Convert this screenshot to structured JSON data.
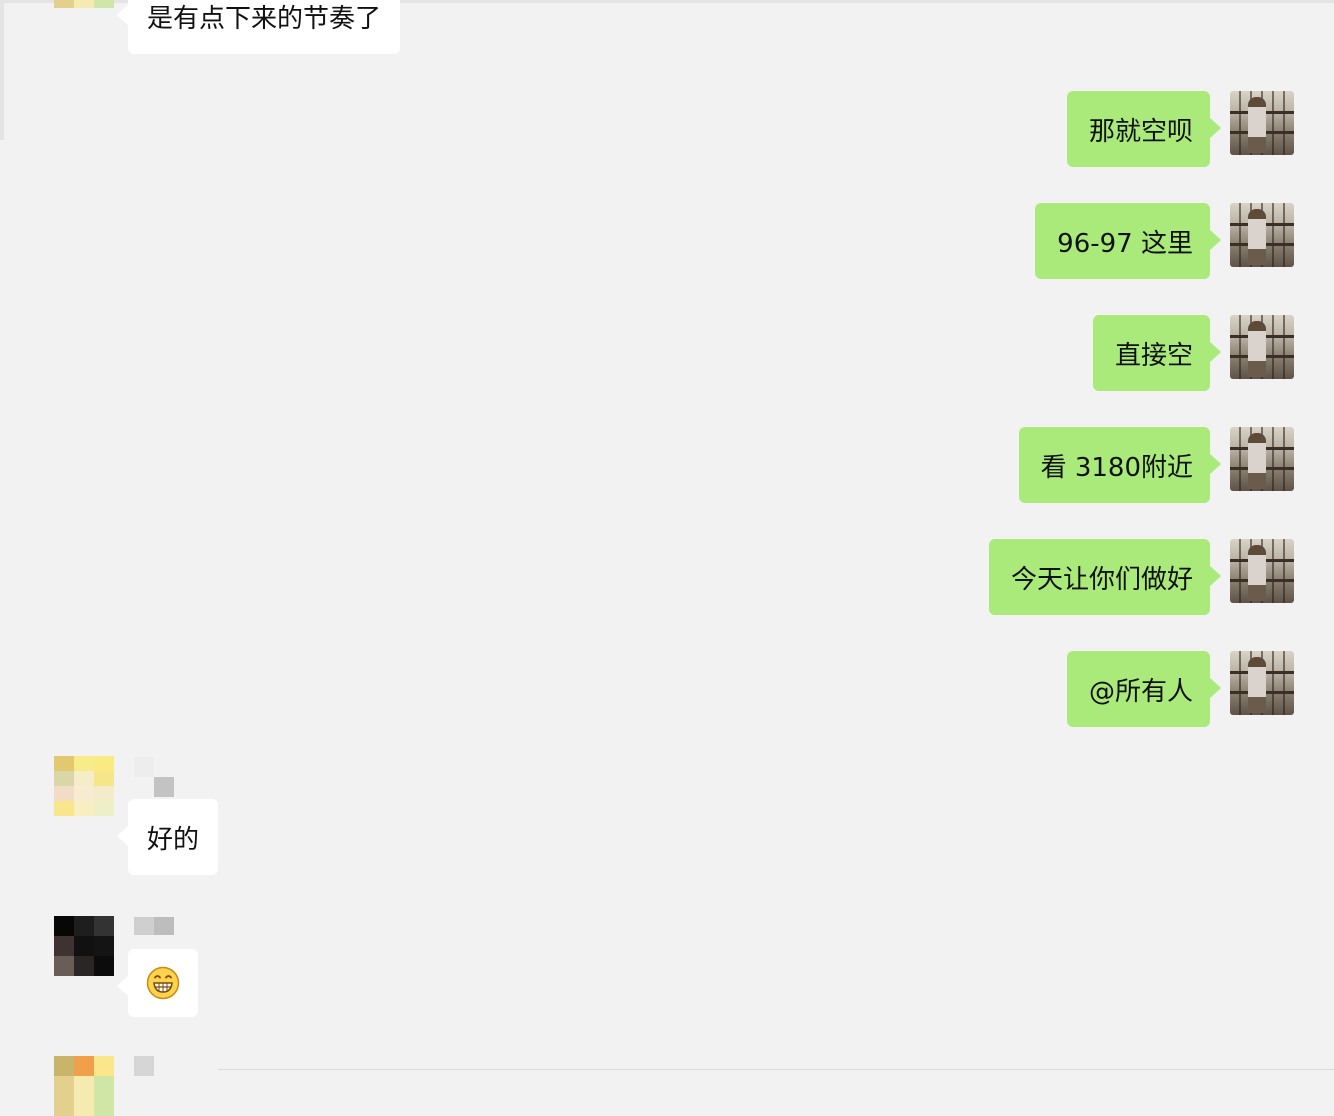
{
  "chat": {
    "messages": [
      {
        "direction": "in",
        "text": "是有点下来的节奏了"
      },
      {
        "direction": "out",
        "text": "那就空呗"
      },
      {
        "direction": "out",
        "text": "96-97 这里"
      },
      {
        "direction": "out",
        "text": "直接空"
      },
      {
        "direction": "out",
        "text": "看 3180附近"
      },
      {
        "direction": "out",
        "text": "今天让你们做好"
      },
      {
        "direction": "out",
        "text": "@所有人"
      },
      {
        "direction": "in",
        "text": "好的"
      },
      {
        "direction": "in",
        "emoji": "grinning-face-emoji"
      }
    ]
  },
  "colors": {
    "background": "#f2f2f2",
    "outgoing_bubble": "#a9ea7a",
    "incoming_bubble": "#ffffff",
    "text": "#111111"
  }
}
